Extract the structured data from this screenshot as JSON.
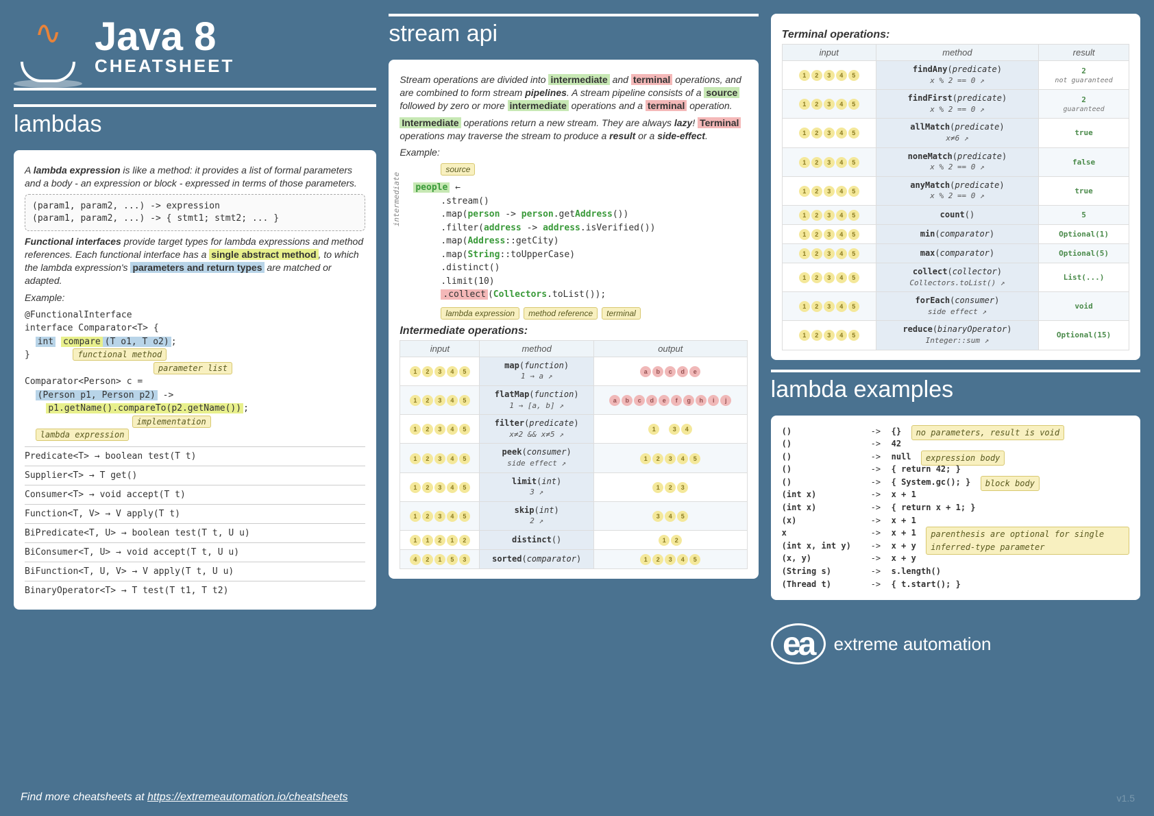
{
  "header": {
    "title": "Java 8",
    "subtitle": "CHEATSHEET"
  },
  "sections": {
    "lambdas": "lambdas",
    "stream_api": "stream api",
    "lambda_examples": "lambda examples"
  },
  "lambdas": {
    "intro_html": "A <b><i>lambda expression</i></b> is like a method: it provides a list of formal parameters and a body - an expression or block - expressed in terms of those parameters.",
    "syntax": "(param1, param2, ...) -> expression\n(param1, param2, ...) -> { stmt1; stmt2; ... }",
    "func_iface_html": "<b><i>Functional interfaces</i></b> provide target types for lambda expressions and method references. Each functional interface has a <b class='hl-y'>single abstract method</b>, to which the lambda expression's <span class='hl-b'><b>parameters and return types</b></span> are matched or adapted.",
    "example_label": "Example:",
    "example_code": "@FunctionalInterface\ninterface Comparator<T> {\n  int compare(T o1, T o2);\n}\n\nComparator<Person> c =\n  (Person p1, Person p2) ->\n    p1.getName().compareTo(p2.getName());",
    "annotations": {
      "functional_method": "functional method",
      "parameter_list": "parameter list",
      "implementation": "implementation",
      "lambda_expression": "lambda expression"
    },
    "func_list": [
      "Predicate<T> → boolean test(T t)",
      "Supplier<T> → T get()",
      "Consumer<T> → void accept(T t)",
      "Function<T, V> → V apply(T t)",
      "BiPredicate<T, U> → boolean test(T t, U u)",
      "BiConsumer<T, U> → void accept(T t, U u)",
      "BiFunction<T, U, V> → V apply(T t, U u)",
      "BinaryOperator<T> → T test(T t1, T t2)"
    ]
  },
  "stream": {
    "intro1_html": "Stream operations are divided into <b class='hl-g'>intermediate</b> and <b class='hl-p'>terminal</b> operations, and are combined to form stream <b><i>pipelines</i></b>. A stream pipeline consists of a <b class='hl-g'>source</b> followed by zero or more <b class='hl-g'>intermediate</b> operations and a <b class='hl-p'>terminal</b> operation.",
    "intro2_html": "<b class='hl-g'>Intermediate</b> operations return a new stream. They are always <b><i>lazy</i></b>! <b class='hl-p'>Terminal</b> operations may traverse the stream to produce a <b><i>result</i></b> or a <b><i>side-effect</i></b>.",
    "example_label": "Example:",
    "tags": {
      "source": "source",
      "lambda": "lambda expression",
      "method_ref": "method reference",
      "terminal": "terminal",
      "intermediate": "intermediate"
    },
    "example_people": "people",
    "example_lines": [
      ".stream()",
      ".map(person -> person.getAddress())",
      ".filter(address -> address.isVerified())",
      ".map(Address::getCity)",
      ".map(String::toUpperCase)",
      ".distinct()",
      ".limit(10)",
      ".collect(Collectors.toList());"
    ],
    "intermediate_header": "Intermediate operations:",
    "intermediate_cols": [
      "input",
      "method",
      "output"
    ],
    "intermediate_ops": [
      {
        "in": "12345",
        "m": "map(<i>function</i>)",
        "sub": "1 → a",
        "out": "abcde",
        "out_style": "r"
      },
      {
        "in": "12345",
        "m": "flatMap(<i>function</i>)",
        "sub": "1 → [a, b]",
        "out": "abcdefghij",
        "out_style": "r"
      },
      {
        "in": "12345",
        "m": "filter(<i>predicate</i>)",
        "sub": "x≠2 && x≠5",
        "out": "1 34",
        "out_style": "y"
      },
      {
        "in": "12345",
        "m": "peek(<i>consumer</i>)",
        "sub": "side effect",
        "out": "12345",
        "out_style": "y"
      },
      {
        "in": "12345",
        "m": "limit(<i>int</i>)",
        "sub": "3",
        "out": "123",
        "out_style": "y"
      },
      {
        "in": "12345",
        "m": "skip(<i>int</i>)",
        "sub": "2",
        "out": "345",
        "out_style": "y"
      },
      {
        "in": "11212",
        "m": "distinct()",
        "sub": "",
        "out": "12",
        "out_style": "y"
      },
      {
        "in": "42153",
        "m": "sorted(<i>comparator</i>)",
        "sub": "",
        "out": "12345",
        "out_style": "y"
      }
    ],
    "terminal_header": "Terminal operations:",
    "terminal_cols": [
      "input",
      "method",
      "result"
    ],
    "terminal_ops": [
      {
        "in": "12345",
        "m": "findAny(<i>predicate</i>)",
        "sub": "x % 2 == 0",
        "r": "2",
        "note": "not guaranteed"
      },
      {
        "in": "12345",
        "m": "findFirst(<i>predicate</i>)",
        "sub": "x % 2 == 0",
        "r": "2",
        "note": "guaranteed"
      },
      {
        "in": "12345",
        "m": "allMatch(<i>predicate</i>)",
        "sub": "x≠6",
        "r": "true",
        "note": ""
      },
      {
        "in": "12345",
        "m": "noneMatch(<i>predicate</i>)",
        "sub": "x % 2 == 0",
        "r": "false",
        "note": ""
      },
      {
        "in": "12345",
        "m": "anyMatch(<i>predicate</i>)",
        "sub": "x % 2 == 0",
        "r": "true",
        "note": ""
      },
      {
        "in": "12345",
        "m": "count()",
        "sub": "",
        "r": "5",
        "note": ""
      },
      {
        "in": "12345",
        "m": "min(<i>comparator</i>)",
        "sub": "",
        "r": "Optional(1)",
        "note": ""
      },
      {
        "in": "12345",
        "m": "max(<i>comparator</i>)",
        "sub": "",
        "r": "Optional(5)",
        "note": ""
      },
      {
        "in": "12345",
        "m": "collect(<i>collector</i>)",
        "sub": "Collectors.toList()",
        "r": "List(...)",
        "note": ""
      },
      {
        "in": "12345",
        "m": "forEach(<i>consumer</i>)",
        "sub": "side effect",
        "r": "void",
        "note": ""
      },
      {
        "in": "12345",
        "m": "reduce(<i>binaryOperator</i>)",
        "sub": "Integer::sum",
        "r": "Optional(15)",
        "note": ""
      }
    ]
  },
  "lambda_ex": {
    "rows": [
      {
        "l": "()",
        "r": "{}",
        "note": "no parameters, result is void"
      },
      {
        "l": "()",
        "r": "42",
        "note": ""
      },
      {
        "l": "()",
        "r": "null",
        "note": "expression body"
      },
      {
        "l": "()",
        "r": "{ return 42; }",
        "note": ""
      },
      {
        "l": "()",
        "r": "{ System.gc(); }",
        "note": "block body"
      },
      {
        "l": "(int x)",
        "r": "x + 1",
        "note": ""
      },
      {
        "l": "(int x)",
        "r": "{ return x + 1; }",
        "note": ""
      },
      {
        "l": "(x)",
        "r": "x + 1",
        "note": ""
      },
      {
        "l": "x",
        "r": "x + 1",
        "note": "parenthesis are optional for single inferred-type parameter"
      },
      {
        "l": "(int x, int y)",
        "r": "x + y",
        "note": ""
      },
      {
        "l": "(x, y)",
        "r": "x + y",
        "note": ""
      },
      {
        "l": "(String s)",
        "r": "s.length()",
        "note": ""
      },
      {
        "l": "(Thread t)",
        "r": "{ t.start(); }",
        "note": ""
      }
    ]
  },
  "footer": {
    "text": "Find more cheatsheets at ",
    "link": "https://extremeautomation.io/cheatsheets",
    "brand": "extreme automation",
    "version": "v1.5"
  }
}
